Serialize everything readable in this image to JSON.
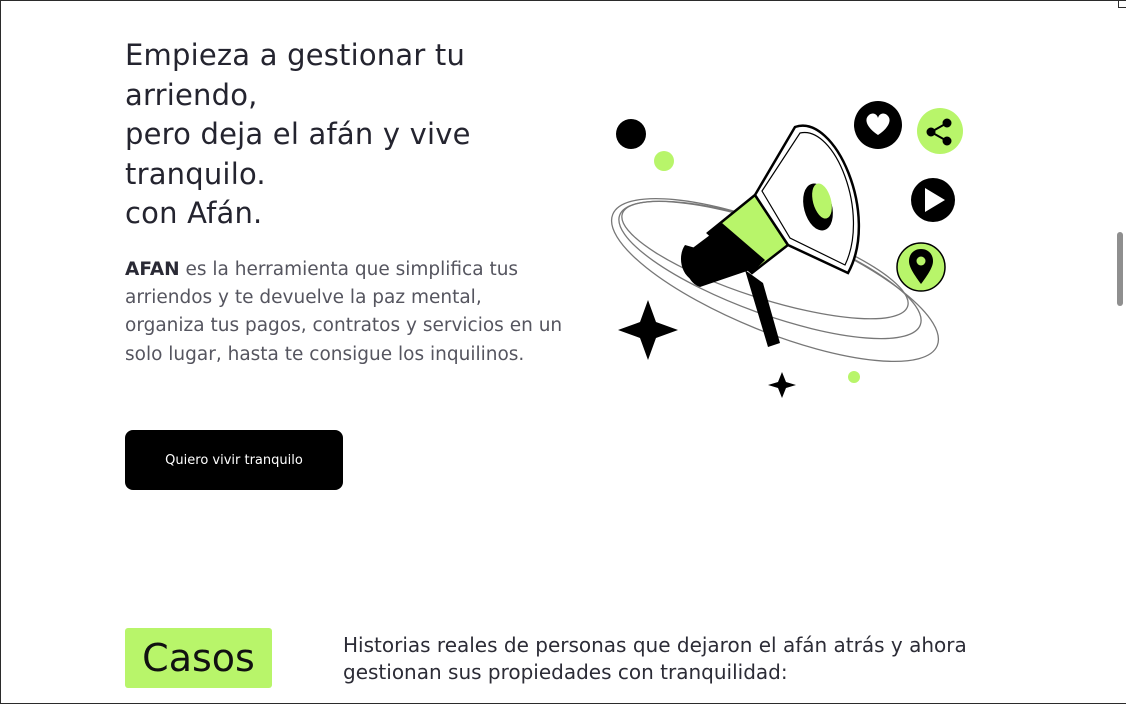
{
  "hero": {
    "title_lines": [
      "Empieza a gestionar tu",
      "arriendo,",
      "pero deja el afán y vive",
      "tranquilo.",
      "con Afán."
    ],
    "desc_brand": "AFAN",
    "desc_text": " es la herramienta que simplifica tus arriendos y te devuelve la paz mental, organiza tus pagos, contratos y servicios en un solo lugar, hasta te consigue los inquilinos.",
    "cta_label": "Quiero vivir tranquilo"
  },
  "illustration": {
    "accent": "#b8f56a",
    "icons": [
      "megaphone-icon",
      "heart-icon",
      "share-icon",
      "play-icon",
      "location-pin-icon",
      "sparkle-icon"
    ]
  },
  "casos": {
    "badge": "Casos",
    "description": "Historias reales de personas que dejaron el afán atrás y ahora gestionan sus propiedades con tranquilidad:"
  },
  "colors": {
    "accent_green": "#b8f56a",
    "button_bg": "#000000",
    "text_dark": "#24242f"
  }
}
